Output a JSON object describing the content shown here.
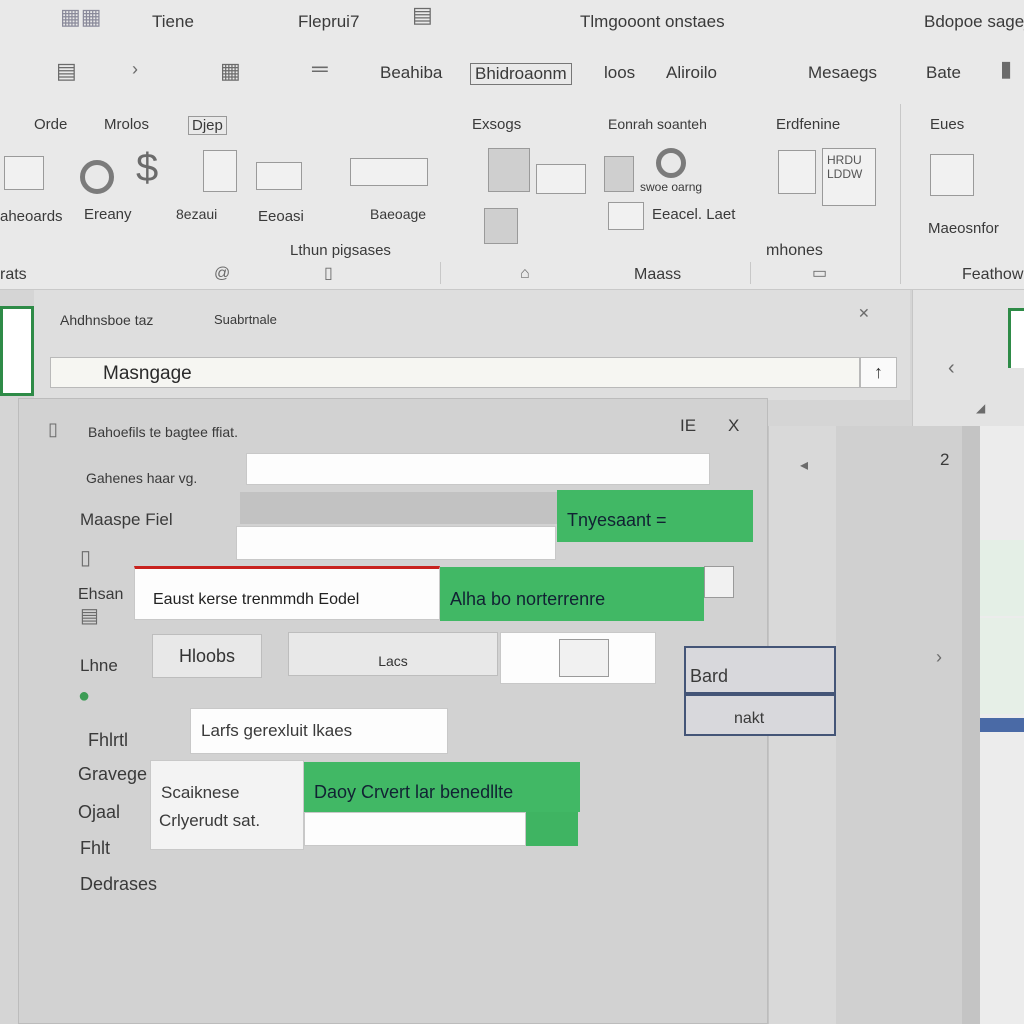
{
  "titlebar": {
    "tabs": [
      "Tiene",
      "Fleprui7",
      "Tlmgooont onstaes",
      "Bdopoe sagej"
    ]
  },
  "ribbon": {
    "row2": [
      "Beahiba",
      "Bhidroaonm",
      "loos",
      "Aliroilo",
      "Mesaegs",
      "Bate"
    ],
    "row3": [
      "Orde",
      "Mrolos",
      "Djep",
      "Exsogs",
      "Eonrah soanteh",
      "Erdfenine",
      "Eues"
    ],
    "labels": {
      "aheomds": "aheoards",
      "erean": "Ereany",
      "ewaonl": "8ezaui",
      "ewish": "Eeoasi",
      "bserage": "Baeoage",
      "swoecao": "swoe oarng",
      "eacel": "Eeacel. Laet",
      "gmonaag": "Maeosnfor",
      "ltiunm": "Lthun pigsases",
      "mhones": "mhones",
      "masss": "Maass",
      "feathow": "Feathow",
      "rats": "rats",
      "hrou": "HRDU\nLDDW"
    }
  },
  "message": {
    "header_text": "Ahdhnsboe taz",
    "header_sub": "Suabrtnale",
    "bar_text": "Masngage",
    "bar_btn": "↑"
  },
  "dialog": {
    "title": "Bahoefils te bagtee ffiat.",
    "ctrl_a": "IE",
    "ctrl_close": "X",
    "label_1": "Gahenes haar vg.",
    "label_2": "Maaspe Fiel",
    "btn_translate": "Tnyesaant =",
    "left_words": [
      "Ehsan",
      "Lhne",
      "Fhlrtl",
      "Gravege",
      "Ojaal",
      "Fhlt",
      "Dedrases"
    ],
    "red_field": "Eaust kerse trenmmdh Eodel",
    "btn_alhbo": "Alha bo norterrenre",
    "hasobs_btn": "Hloobs",
    "grey_btn": "Lacs",
    "field_3": "Larfs  gerexluit lkaes",
    "bubble_line1": "Scaiknese",
    "bubble_line2": "Crlyerudt sat.",
    "btn_daoy": "Daoy Crvert lar benedllte",
    "num_2": "2",
    "side_btn_1": "Bard",
    "side_btn_2": "nakt"
  }
}
